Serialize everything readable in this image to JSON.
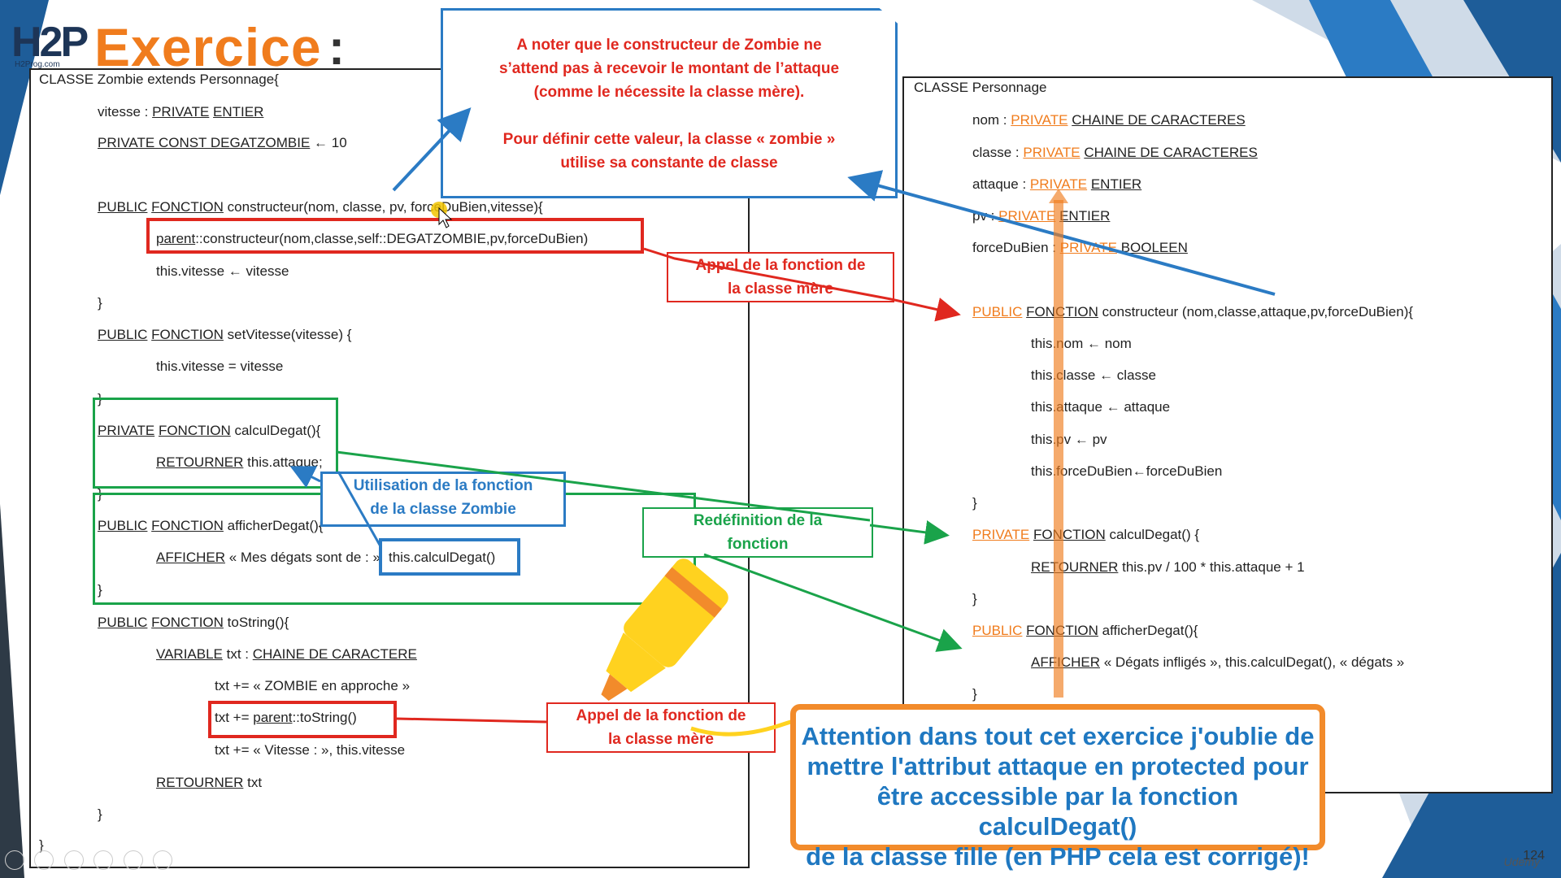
{
  "logo": {
    "main": "H2P",
    "sub": "H2Prog.com"
  },
  "title": "Exercice",
  "title_colon": ":",
  "note": {
    "line1": "A noter que le constructeur de Zombie ne",
    "line2": "s’attend pas à recevoir le montant de l’attaque",
    "line3": "(comme le nécessite la classe mère).",
    "line4": "Pour définir cette valeur, la classe « zombie »",
    "line5": "utilise sa constante de classe"
  },
  "zombie": {
    "l0": "CLASSE Zombie extends Personnage{",
    "l1a": "vitesse : ",
    "l1b": "PRIVATE",
    "l1c": "ENTIER",
    "l2a": "PRIVATE CONST DEGATZOMBIE",
    "l2b": " ← 10",
    "l3a": "PUBLIC",
    "l3b": "FONCTION",
    "l3c": " constructeur(nom, classe, pv, forceDuBien,vitesse){",
    "l4a": "parent",
    "l4b": "::constructeur(nom,classe,self::DEGATZOMBIE,pv,forceDuBien)",
    "l5": "this.vitesse ← vitesse",
    "l6": "}",
    "l7a": "PUBLIC",
    "l7b": "FONCTION",
    "l7c": " setVitesse(vitesse) {",
    "l8": "this.vitesse = vitesse",
    "l9": "}",
    "l10a": "PRIVATE",
    "l10b": "FONCTION",
    "l10c": " calculDegat(){",
    "l11a": "RETOURNER",
    "l11b": " this.attaque;",
    "l12": "}",
    "l13a": "PUBLIC",
    "l13b": "FONCTION",
    "l13c": " afficherDegat(){",
    "l14a": "AFFICHER",
    "l14b": " « Mes dégats sont de : »",
    "l14c": "this.calculDegat()",
    "l15": "}",
    "l16a": "PUBLIC",
    "l16b": "FONCTION",
    "l16c": " toString(){",
    "l17a": "VARIABLE",
    "l17b": " txt : ",
    "l17c": "CHAINE DE CARACTERE",
    "l18": "txt += « ZOMBIE en approche »",
    "l19a": "txt += ",
    "l19b": "parent",
    "l19c": "::toString()",
    "l20": "txt += « Vitesse : », this.vitesse",
    "l21a": "RETOURNER",
    "l21b": " txt",
    "l22": "}",
    "l23": "}"
  },
  "personnage": {
    "l0": "CLASSE Personnage",
    "l1a": "nom : ",
    "l1b": "PRIVATE",
    "l1c": "CHAINE DE CARACTERES",
    "l2a": "classe : ",
    "l2b": "PRIVATE",
    "l2c": "CHAINE DE CARACTERES",
    "l3a": "attaque : ",
    "l3b": "PRIVATE",
    "l3c": "ENTIER",
    "l4a": "pv : ",
    "l4b": "PRIVATE",
    "l4c": "ENTIER",
    "l5a": "forceDuBien : ",
    "l5b": "PRIVATE",
    "l5c": "BOOLEEN",
    "l6a": "PUBLIC",
    "l6b": "FONCTION",
    "l6c": " constructeur (nom,classe,attaque,pv,forceDuBien){",
    "l7": "this.nom ← nom",
    "l8": "this.classe ← classe",
    "l9": "this.attaque ← attaque",
    "l10": "this.pv ← pv",
    "l11": "this.forceDuBien←forceDuBien",
    "l12": "}",
    "l13a": "PRIVATE",
    "l13b": "FONCTION",
    "l13c": " calculDegat() {",
    "l14a": "RETOURNER",
    "l14b": " this.pv / 100 * this.attaque + 1",
    "l15": "}",
    "l16a": "PUBLIC",
    "l16b": "FONCTION",
    "l16c": " afficherDegat(){",
    "l17a": "AFFICHER",
    "l17b": " « Dégats infligés », this.calculDegat(), « dégats »",
    "l18": "}"
  },
  "callouts": {
    "parent_call_1": [
      "Appel de la fonction de",
      "la classe mère"
    ],
    "zombie_use": [
      "Utilisation de la fonction",
      "de la classe Zombie"
    ],
    "redef": [
      "Redéfinition de la",
      "fonction"
    ],
    "parent_call_2": [
      "Appel de la fonction de",
      "la classe mère"
    ]
  },
  "warning": {
    "l1": "Attention dans tout cet exercice j'oublie de",
    "l2": "mettre l'attribut attaque en protected pour",
    "l3": "être accessible par la fonction calculDegat()",
    "l4": "de la classe fille (en PHP cela est corrigé)!"
  },
  "page_number": "124",
  "watermark": "Udemy",
  "colors": {
    "orange": "#f07c1d",
    "red": "#e0281f",
    "blue": "#2b7bc4",
    "green": "#1aa34a",
    "navy": "#1d3557"
  }
}
